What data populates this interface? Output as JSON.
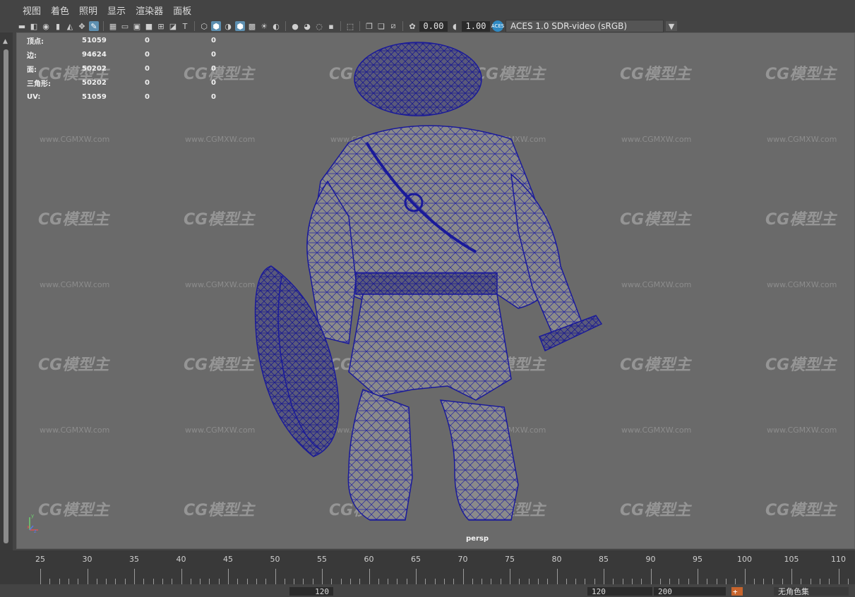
{
  "menu": {
    "items": [
      "视图",
      "着色",
      "照明",
      "显示",
      "渲染器",
      "面板"
    ]
  },
  "toolbar": {
    "exposure_value": "0.00",
    "gamma_value": "1.00",
    "color_space": "ACES 1.0 SDR-video (sRGB)",
    "color_space_icon": "ACES",
    "icons": [
      "select-camera-icon",
      "camera-attributes-icon",
      "bookmark-icon",
      "image-plane-icon",
      "2d-pan-zoom-icon",
      "grease-pencil-icon",
      "grid-icon",
      "film-gate-icon",
      "resolution-gate-icon",
      "gate-mask-icon",
      "field-chart-icon",
      "safe-action-icon",
      "safe-title-icon",
      "wireframe-icon",
      "smooth-shade-icon",
      "default-material-icon",
      "textured-icon",
      "wireframe-on-shaded-icon",
      "xray-icon",
      "use-all-lights-icon",
      "shadows-icon",
      "ambient-occlusion-icon",
      "motion-blur-icon",
      "antialias-icon",
      "isolate-select-icon",
      "xray-joints-icon",
      "xray-active-icon",
      "backface-icon",
      "exposure-icon",
      "gamma-icon"
    ]
  },
  "hud": {
    "rows": [
      {
        "label": "顶点:",
        "v1": "51059",
        "v2": "0",
        "v3": "0"
      },
      {
        "label": "边:",
        "v1": "94624",
        "v2": "0",
        "v3": "0"
      },
      {
        "label": "面:",
        "v1": "50202",
        "v2": "0",
        "v3": "0"
      },
      {
        "label": "三角形:",
        "v1": "50202",
        "v2": "0",
        "v3": "0"
      },
      {
        "label": "UV:",
        "v1": "51059",
        "v2": "0",
        "v3": "0"
      }
    ]
  },
  "viewport": {
    "camera_label": "persp",
    "axis_x": "x",
    "axis_y": "y",
    "axis_z": "z",
    "wireframe_color": "#1a1a9a",
    "background_color": "#6a6a6a"
  },
  "watermark": {
    "logo": "CG模型主",
    "url": "www.CGMXW.com"
  },
  "timeline": {
    "ticks": [
      "25",
      "30",
      "35",
      "40",
      "45",
      "50",
      "55",
      "60",
      "65",
      "70",
      "75",
      "80",
      "85",
      "90",
      "95",
      "100",
      "105",
      "110"
    ]
  },
  "bottombar": {
    "range_end": "120",
    "playback_start": "120",
    "playback_end": "200",
    "character_set": "无角色集"
  }
}
